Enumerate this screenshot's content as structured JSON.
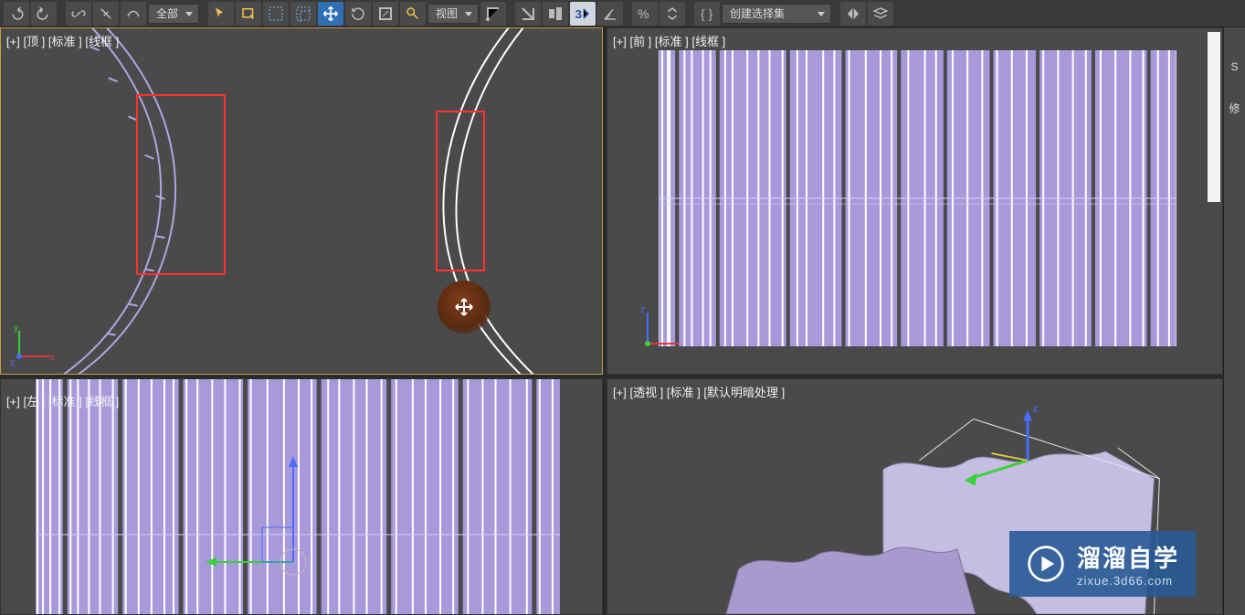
{
  "toolbar": {
    "filter_dropdown": "全部",
    "view_dropdown": "视图",
    "selection_set_label": "创建选择集",
    "icons": [
      "undo-icon",
      "redo-icon",
      "link-icon",
      "unlink-icon",
      "bind-icon",
      "wave-icon",
      "arrow-icon",
      "select-all-icon",
      "marquee-icon",
      "marquee-crossing-icon",
      "window-icon",
      "move-icon",
      "rotate-icon",
      "scale-icon",
      "placement-icon",
      "reference-coord-icon",
      "snap-toggle-icon",
      "snap-icon",
      "angle-snap-icon",
      "mirror-icon",
      "percent-snap-icon",
      "spinner-snap-icon",
      "named-selection-icon",
      "layers-icon",
      "schematic-icon"
    ]
  },
  "viewports": {
    "top": {
      "plus": "[+]",
      "name": "[顶 ]",
      "style": "[标准 ]",
      "mode": "[线框 ]"
    },
    "front": {
      "plus": "[+]",
      "name": "[前 ]",
      "style": "[标准 ]",
      "mode": "[线框 ]"
    },
    "left": {
      "plus": "[+]",
      "name": "[左 ]",
      "style": "[标准 ]",
      "mode": "[线框 ]"
    },
    "persp": {
      "plus": "[+]",
      "name": "[透视 ]",
      "style": "[标准 ]",
      "mode": "[默认明暗处理 ]"
    }
  },
  "side_panel": {
    "label1": "S",
    "label2": "修"
  },
  "watermark": {
    "title": "溜溜自学",
    "sub": "zixue.3d66.com"
  }
}
